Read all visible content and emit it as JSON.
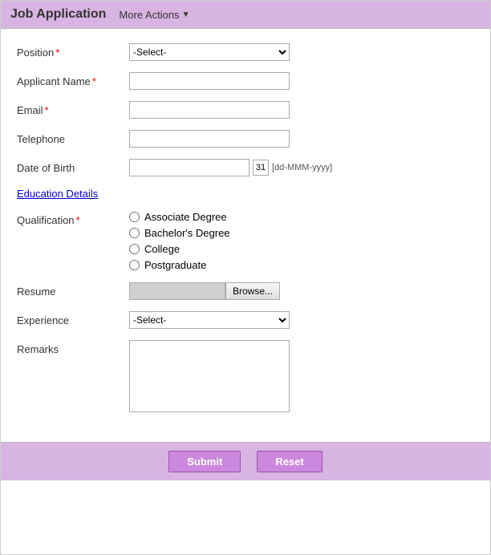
{
  "header": {
    "title": "Job Application",
    "more_actions_label": "More Actions",
    "more_actions_arrow": "▼"
  },
  "form": {
    "position_label": "Position",
    "position_placeholder": "-Select-",
    "applicant_name_label": "Applicant Name",
    "email_label": "Email",
    "telephone_label": "Telephone",
    "dob_label": "Date of Birth",
    "dob_placeholder": "",
    "dob_format": "[dd-MMM-yyyy]",
    "calendar_icon": "31",
    "education_section_title": "Education Details",
    "qualification_label": "Qualification",
    "qualification_options": [
      "Associate Degree",
      "Bachelor's Degree",
      "College",
      "Postgraduate"
    ],
    "resume_label": "Resume",
    "browse_label": "Browse...",
    "experience_label": "Experience",
    "experience_placeholder": "-Select-",
    "remarks_label": "Remarks"
  },
  "footer": {
    "submit_label": "Submit",
    "reset_label": "Reset"
  }
}
